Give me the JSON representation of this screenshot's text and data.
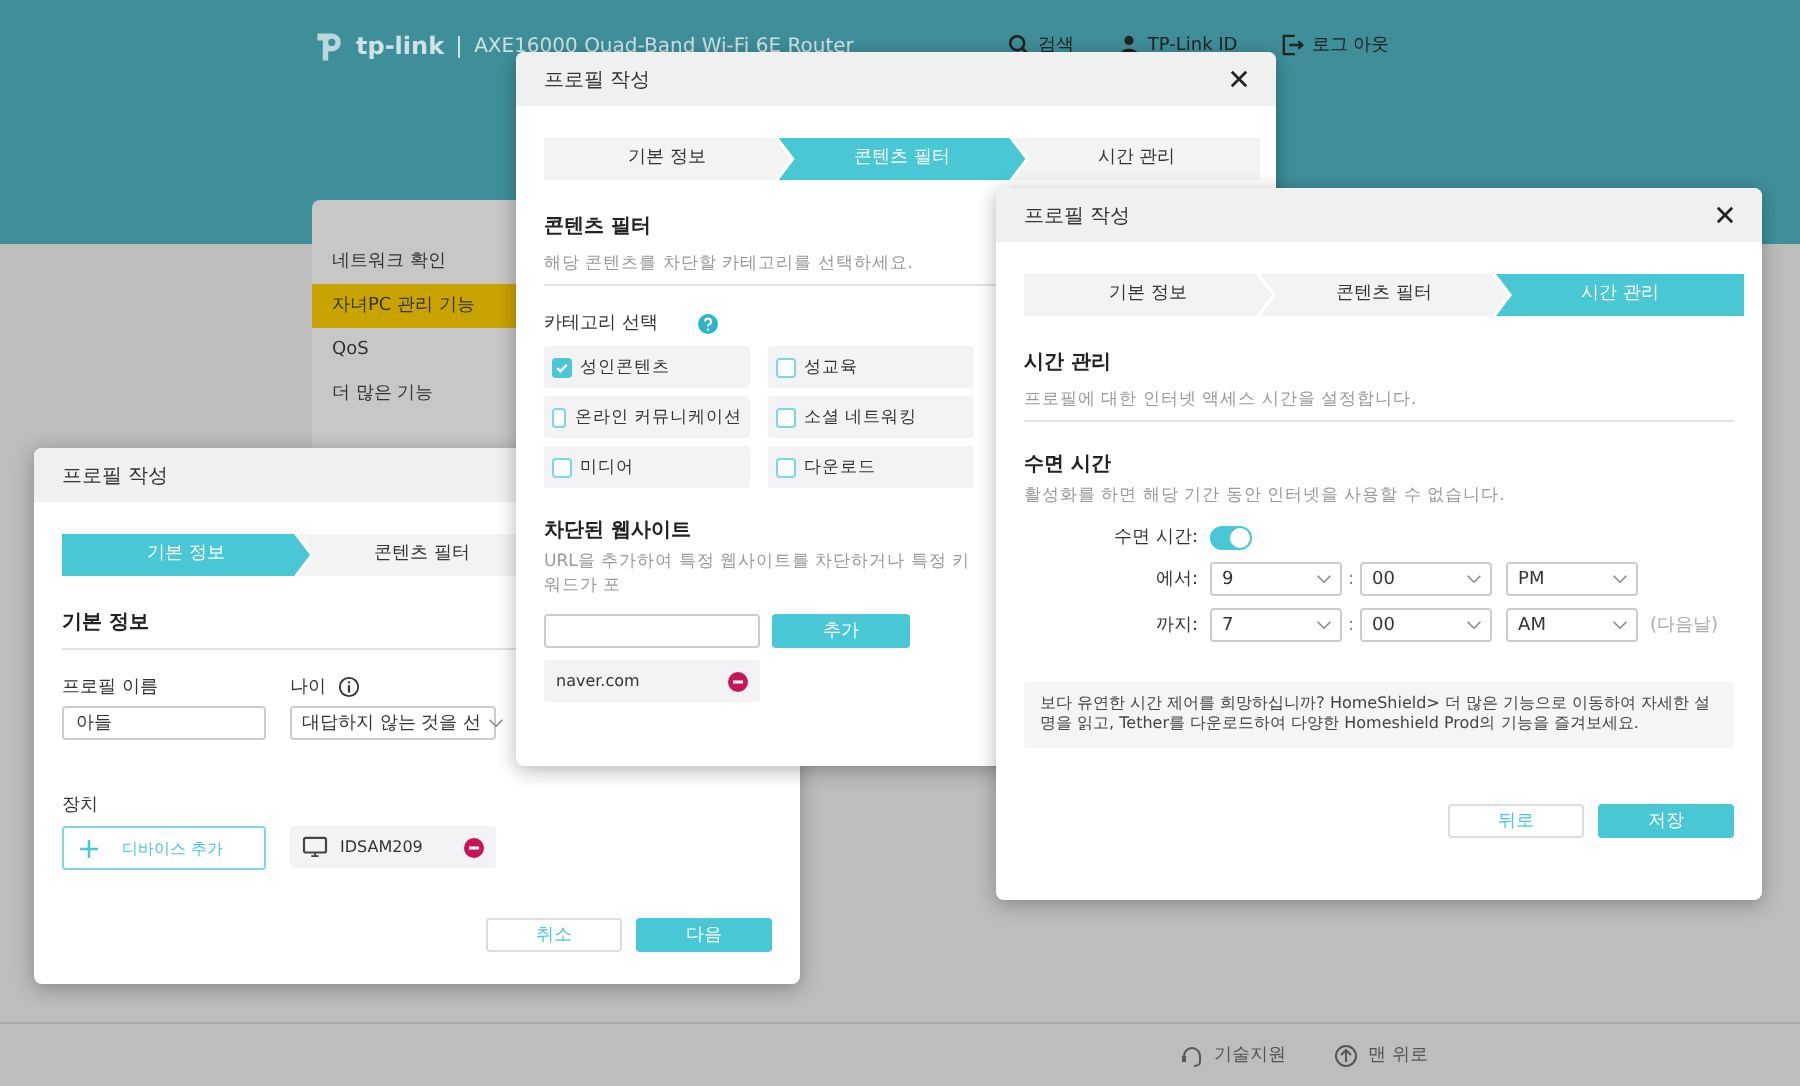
{
  "header": {
    "logo": "tp-link",
    "product": "AXE16000 Quad-Band Wi-Fi 6E Router",
    "nav": [
      {
        "kind": "search",
        "label": "검색"
      },
      {
        "kind": "id",
        "label": "TP-Link ID"
      },
      {
        "kind": "logout",
        "label": "로그 아웃"
      }
    ]
  },
  "sidebar": {
    "items": [
      {
        "label": "네트워크 확인",
        "selected": false
      },
      {
        "label": "자녀PC 관리 기능",
        "selected": true
      },
      {
        "label": "QoS",
        "selected": false
      },
      {
        "label": "더 많은 기능",
        "selected": false
      }
    ]
  },
  "footer": {
    "links": [
      {
        "kind": "support",
        "label": "기술지원"
      },
      {
        "kind": "top",
        "label": "맨 위로"
      }
    ]
  },
  "dialogs": [
    {
      "kind": "basic",
      "title": "프로필 작성",
      "closable": false,
      "steps": [
        {
          "label": "기본 정보",
          "selected": true
        },
        {
          "label": "콘텐츠 필터",
          "selected": false
        }
      ],
      "section": "기본 정보",
      "name_label": "프로필 이름",
      "name_value": "아들",
      "age_label": "나이",
      "age_value": "대답하지 않는 것을 선",
      "device_label": "장치",
      "add_device": "디바이스 추가",
      "devices": [
        {
          "name": "IDSAM209"
        }
      ],
      "cancel": "취소",
      "next": "다음"
    },
    {
      "kind": "filter",
      "title": "프로필 작성",
      "closable": true,
      "steps": [
        {
          "label": "기본 정보",
          "selected": false
        },
        {
          "label": "콘텐츠 필터",
          "selected": true
        },
        {
          "label": "시간 관리",
          "selected": false
        }
      ],
      "section": "콘텐츠 필터",
      "description": "해당 콘텐츠를 차단할 카테고리를 선택하세요.",
      "category_label": "카테고리 선택",
      "categories": [
        {
          "label": "성인콘텐츠",
          "checked": true
        },
        {
          "label": "성교육",
          "checked": false
        },
        {
          "label": "온라인 커뮤니케이션",
          "checked": false
        },
        {
          "label": "소셜 네트워킹",
          "checked": false
        },
        {
          "label": "미디어",
          "checked": false
        },
        {
          "label": "다운로드",
          "checked": false
        }
      ],
      "blocked_title": "차단된 웹사이트",
      "blocked_desc": "URL을 추가하여 특정 웹사이트를 차단하거나 특정 키워드가 포",
      "add": "추가",
      "sites": [
        {
          "url": "naver.com"
        }
      ]
    },
    {
      "kind": "time",
      "title": "프로필 작성",
      "closable": true,
      "steps": [
        {
          "label": "기본 정보",
          "selected": false
        },
        {
          "label": "콘텐츠 필터",
          "selected": false
        },
        {
          "label": "시간 관리",
          "selected": true
        }
      ],
      "section": "시간 관리",
      "description": "프로필에 대한 인터넷 액세스 시간을 설정합니다.",
      "sleep_title": "수면 시간",
      "sleep_desc": "활성화를 하면 해당 기간 동안 인터넷을 사용할 수 없습니다.",
      "toggle": {
        "label": "수면 시간:",
        "on": true
      },
      "rows": [
        {
          "label": "에서:",
          "hour": "9",
          "separator": ":",
          "minute": "00",
          "ampm": "PM"
        },
        {
          "label": "까지:",
          "hour": "7",
          "separator": ":",
          "minute": "00",
          "ampm": "AM",
          "note": "(다음날)"
        }
      ],
      "info": "보다 유연한 시간 제어를 희망하십니까? HomeShield> 더 많은 기능으로 이동하여 자세한 설명을 읽고, Tether를 다운로드하여 다양한 Homeshield Prod의 기능을 즐겨보세요.",
      "back": "뒤로",
      "save": "저장"
    }
  ]
}
